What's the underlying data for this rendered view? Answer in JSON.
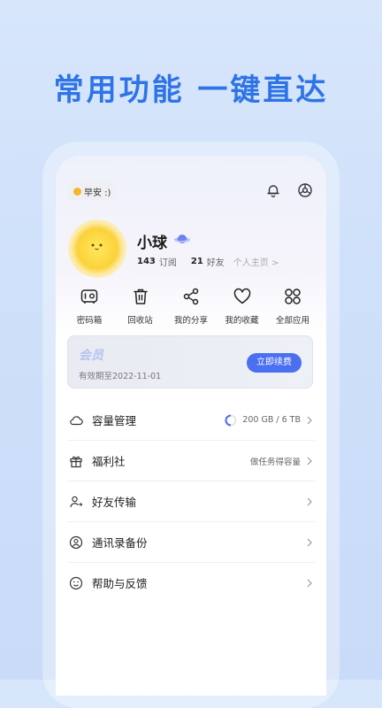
{
  "headline": "常用功能  一键直达",
  "greeting": "早安 :)",
  "profile": {
    "username": "小球",
    "subscriptions_count": "143",
    "subscriptions_label": "订阅",
    "friends_count": "21",
    "friends_label": "好友",
    "homepage_link": "个人主页 >"
  },
  "quick_actions": [
    {
      "label": "密码箱",
      "icon": "safe-box-icon"
    },
    {
      "label": "回收站",
      "icon": "trash-icon"
    },
    {
      "label": "我的分享",
      "icon": "share-icon"
    },
    {
      "label": "我的收藏",
      "icon": "heart-icon"
    },
    {
      "label": "全部应用",
      "icon": "apps-grid-icon"
    }
  ],
  "vip": {
    "title": "会员",
    "expiry": "有效期至2022-11-01",
    "renew_button": "立即续费"
  },
  "menu": [
    {
      "label": "容量管理",
      "icon": "cloud-icon",
      "detail": "200 GB / 6 TB",
      "usage_fraction": 0.03
    },
    {
      "label": "福利社",
      "icon": "gift-icon",
      "detail": "做任务得容量"
    },
    {
      "label": "好友传输",
      "icon": "friend-transfer-icon",
      "detail": ""
    },
    {
      "label": "通讯录备份",
      "icon": "contacts-icon",
      "detail": ""
    },
    {
      "label": "帮助与反馈",
      "icon": "help-smiley-icon",
      "detail": ""
    }
  ],
  "colors": {
    "accent": "#4a6ff0",
    "headline": "#2f74e6",
    "avatar": "#fbd23a"
  }
}
